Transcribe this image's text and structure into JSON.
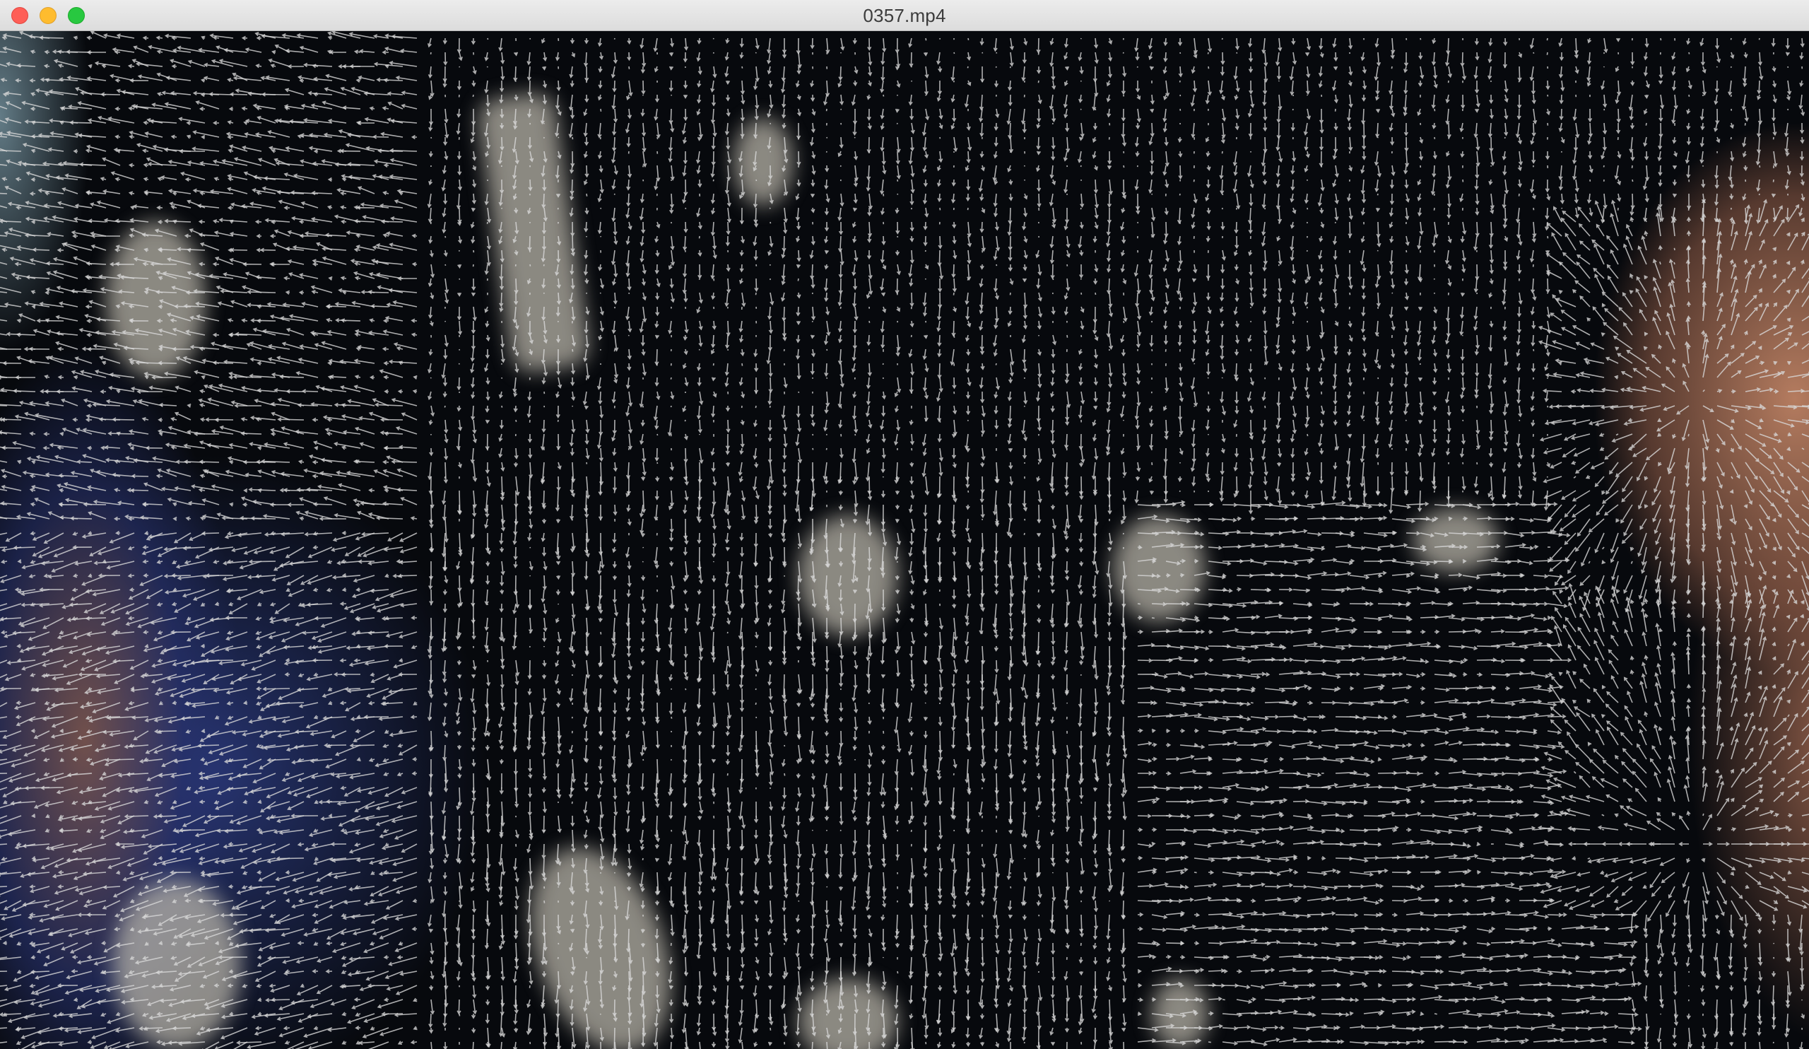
{
  "window": {
    "title": "0357.mp4"
  },
  "titlebar": {
    "buttons": [
      {
        "name": "close-button",
        "color": "#fe5f57"
      },
      {
        "name": "minimize-button",
        "color": "#febc2e"
      },
      {
        "name": "zoom-button",
        "color": "#28c840"
      }
    ]
  },
  "video": {
    "content": "optical-flow-visualization",
    "arrow_color": "#d8d8d8"
  }
}
